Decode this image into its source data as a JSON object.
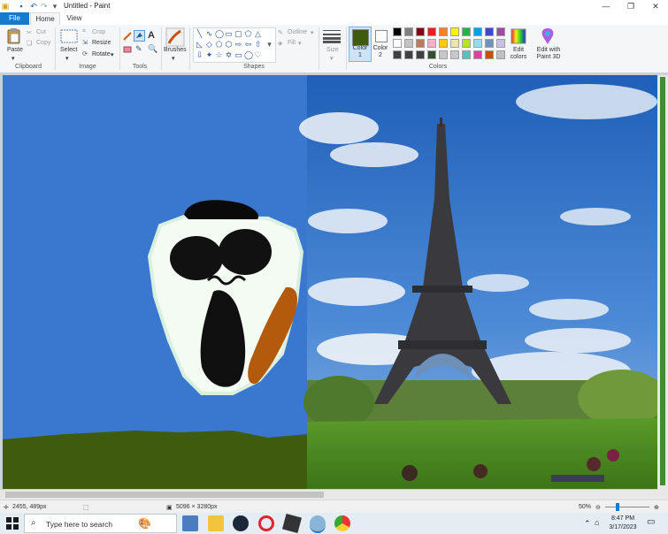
{
  "window": {
    "title": "Untitled - Paint"
  },
  "tabs": {
    "file": "File",
    "home": "Home",
    "view": "View"
  },
  "clipboard": {
    "paste": "Paste",
    "cut": "Cut",
    "copy": "Copy",
    "label": "Clipboard"
  },
  "image": {
    "select": "Select",
    "crop": "Crop",
    "resize": "Resize",
    "rotate": "Rotate",
    "label": "Image"
  },
  "tools": {
    "label": "Tools"
  },
  "brushes": {
    "label": "Brushes"
  },
  "shapes": {
    "outline": "Outline",
    "fill": "Fill",
    "label": "Shapes"
  },
  "size": {
    "label": "Size"
  },
  "colors": {
    "color1_label": "Color 1",
    "color2_label": "Color 2",
    "color1": "#3f5c0e",
    "color2": "#ffffff",
    "edit_colors": "Edit colors",
    "edit_paint3d": "Edit with Paint 3D",
    "label": "Colors",
    "palette_row1": [
      "#000000",
      "#7f7f7f",
      "#880015",
      "#ed1c24",
      "#ff7f27",
      "#fff200",
      "#22b14c",
      "#00a2e8",
      "#3f48cc",
      "#a349a4"
    ],
    "palette_row2": [
      "#ffffff",
      "#c3c3c3",
      "#b97a57",
      "#ffaec9",
      "#ffc90e",
      "#efe4b0",
      "#b5e61d",
      "#99d9ea",
      "#7092be",
      "#c8bfe7"
    ],
    "palette_row3": [
      "#404040",
      "#404040",
      "#404040",
      "#2f4f2f",
      "#c8c8c8",
      "#c8c8c8",
      "#58c0c0",
      "#e040a0",
      "#c85000",
      "#c0c0c0"
    ]
  },
  "status": {
    "cursor": "2455, 489px",
    "image_size": "5096 × 3280px",
    "zoom": "50%"
  },
  "taskbar": {
    "search_placeholder": "Type here to search",
    "time": "8:47 PM",
    "date": "3/17/2023"
  }
}
